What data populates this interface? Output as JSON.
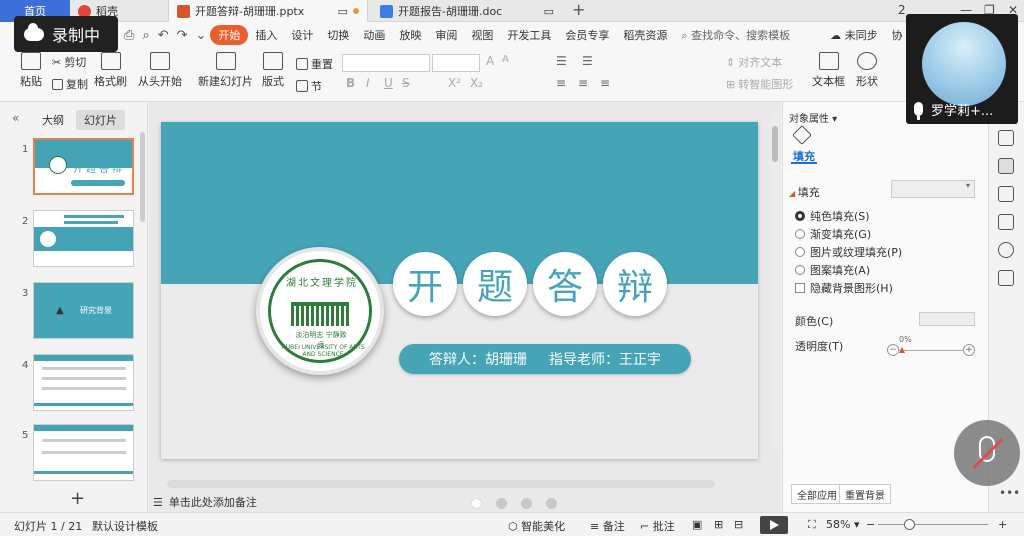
{
  "recording": {
    "label": "录制中"
  },
  "tabs": {
    "home": "首页",
    "docer": "稻壳",
    "active": "开题答辩-胡珊珊.pptx",
    "other": "开题报告-胡珊珊.doc",
    "add": "+"
  },
  "window": {
    "badge": "2"
  },
  "menu": {
    "items": [
      "开始",
      "插入",
      "设计",
      "切换",
      "动画",
      "放映",
      "审阅",
      "视图",
      "开发工具",
      "会员专享",
      "稻壳资源"
    ],
    "search": "查找命令、搜索模板",
    "sync": "未同步",
    "collab": "协"
  },
  "ribbon": {
    "paste": "粘贴",
    "cut": "剪切",
    "copy": "复制",
    "format_painter": "格式刷",
    "from_start": "从头开始",
    "new_slide": "新建幻灯片",
    "layout": "版式",
    "section": "节",
    "reset": "重置",
    "font_size_a": "A",
    "align_text": "对齐文本",
    "smart_art": "转智能图形",
    "textbox": "文本框",
    "shape": "形状"
  },
  "left_panel": {
    "tab_outline": "大纲",
    "tab_slides": "幻灯片",
    "thumbs": [
      {
        "num": "1",
        "title": "开题答辩"
      },
      {
        "num": "2",
        "title": "研究背景"
      },
      {
        "num": "3",
        "title": "研究背景"
      },
      {
        "num": "4",
        "title": ""
      },
      {
        "num": "5",
        "title": ""
      }
    ],
    "add": "+"
  },
  "slide": {
    "logo_top": "湖北文理学院",
    "logo_motto": "淡泊明志 宁静致远",
    "logo_en": "HUBEI UNIVERSITY OF ARTS AND SCIENCE",
    "title_chars": [
      "开",
      "题",
      "答",
      "辩"
    ],
    "presenter": "答辩人：胡珊珊",
    "advisor": "指导老师：王正宇"
  },
  "notes": {
    "placeholder": "单击此处添加备注"
  },
  "props": {
    "header": "对象属性",
    "tab_fill": "填充",
    "section_fill": "填充",
    "options": [
      "纯色填充(S)",
      "渐变填充(G)",
      "图片或纹理填充(P)",
      "图案填充(A)"
    ],
    "hide_bg": "隐藏背景图形(H)",
    "color_label": "颜色(C)",
    "transparency_label": "透明度(T)",
    "transparency_value": "0%",
    "apply_all": "全部应用",
    "reset_bg": "重置背景"
  },
  "video": {
    "name": "罗学莉+..."
  },
  "status": {
    "slide_info": "幻灯片 1 / 21",
    "template": "默认设计模板",
    "smart_beautify": "智能美化",
    "notes": "备注",
    "comments": "批注",
    "zoom": "58%",
    "zoom_minus": "−",
    "zoom_plus": "+"
  },
  "colors": {
    "accent": "#45a5b7",
    "start_tab": "#e85e2f",
    "home_tab": "#3c6fd8"
  }
}
